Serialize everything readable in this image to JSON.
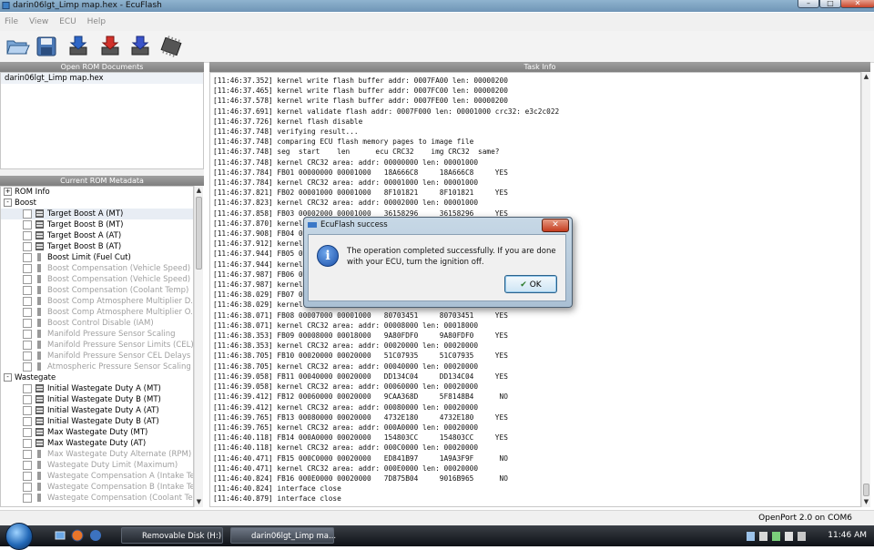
{
  "window": {
    "title": "darin06lgt_Limp map.hex - EcuFlash"
  },
  "menu": [
    "File",
    "View",
    "ECU",
    "Help"
  ],
  "toolbar": {
    "icons": [
      "open-folder-icon",
      "save-disk-icon",
      "read-rom-icon",
      "write-rom-icon",
      "test-write-icon",
      "chip-icon"
    ]
  },
  "left": {
    "open_docs_header": "Open ROM Documents",
    "open_docs": [
      "darin06lgt_Limp map.hex"
    ],
    "metadata_header": "Current ROM Metadata",
    "tree": [
      {
        "kind": "cat",
        "label": "ROM Info",
        "exp": "+"
      },
      {
        "kind": "cat",
        "label": "Boost",
        "exp": "-"
      },
      {
        "kind": "item",
        "label": "Target Boost A (MT)",
        "icon": "grid",
        "dim": false,
        "sel": true
      },
      {
        "kind": "item",
        "label": "Target Boost B (MT)",
        "icon": "grid",
        "dim": false
      },
      {
        "kind": "item",
        "label": "Target Boost A (AT)",
        "icon": "grid",
        "dim": false
      },
      {
        "kind": "item",
        "label": "Target Boost B (AT)",
        "icon": "grid",
        "dim": false
      },
      {
        "kind": "item",
        "label": "Boost Limit (Fuel Cut)",
        "icon": "bar",
        "dim": false
      },
      {
        "kind": "item",
        "label": "Boost Compensation (Vehicle Speed)",
        "icon": "bar",
        "dim": true
      },
      {
        "kind": "item",
        "label": "Boost Compensation (Vehicle Speed)",
        "icon": "bar",
        "dim": true
      },
      {
        "kind": "item",
        "label": "Boost Compensation (Coolant Temp)",
        "icon": "bar",
        "dim": true
      },
      {
        "kind": "item",
        "label": "Boost Comp Atmosphere Multiplier D...",
        "icon": "bar",
        "dim": true
      },
      {
        "kind": "item",
        "label": "Boost Comp Atmosphere Multiplier O...",
        "icon": "bar",
        "dim": true
      },
      {
        "kind": "item",
        "label": "Boost Control Disable (IAM)",
        "icon": "bar",
        "dim": true
      },
      {
        "kind": "item",
        "label": "Manifold Pressure Sensor Scaling",
        "icon": "bar",
        "dim": true
      },
      {
        "kind": "item",
        "label": "Manifold Pressure Sensor Limits (CEL)",
        "icon": "bar",
        "dim": true
      },
      {
        "kind": "item",
        "label": "Manifold Pressure Sensor CEL Delays",
        "icon": "bar",
        "dim": true
      },
      {
        "kind": "item",
        "label": "Atmospheric Pressure Sensor Scaling",
        "icon": "bar",
        "dim": true
      },
      {
        "kind": "cat",
        "label": "Wastegate",
        "exp": "-"
      },
      {
        "kind": "item",
        "label": "Initial Wastegate Duty A (MT)",
        "icon": "grid",
        "dim": false
      },
      {
        "kind": "item",
        "label": "Initial Wastegate Duty B (MT)",
        "icon": "grid",
        "dim": false
      },
      {
        "kind": "item",
        "label": "Initial Wastegate Duty A (AT)",
        "icon": "grid",
        "dim": false
      },
      {
        "kind": "item",
        "label": "Initial Wastegate Duty B (AT)",
        "icon": "grid",
        "dim": false
      },
      {
        "kind": "item",
        "label": "Max Wastegate Duty (MT)",
        "icon": "grid",
        "dim": false
      },
      {
        "kind": "item",
        "label": "Max Wastegate Duty (AT)",
        "icon": "grid",
        "dim": false
      },
      {
        "kind": "item",
        "label": "Max Wastegate Duty Alternate (RPM)",
        "icon": "bar",
        "dim": true
      },
      {
        "kind": "item",
        "label": "Wastegate Duty Limit (Maximum)",
        "icon": "bar",
        "dim": true
      },
      {
        "kind": "item",
        "label": "Wastegate Compensation A (Intake Te...",
        "icon": "bar",
        "dim": true
      },
      {
        "kind": "item",
        "label": "Wastegate Compensation B (Intake Te...",
        "icon": "bar",
        "dim": true
      },
      {
        "kind": "item",
        "label": "Wastegate Compensation (Coolant Te...",
        "icon": "bar",
        "dim": true
      }
    ]
  },
  "task_info": {
    "header": "Task Info",
    "lines": [
      "[11:46:37.352] kernel write flash buffer addr: 0007FA00 len: 00000200",
      "[11:46:37.465] kernel write flash buffer addr: 0007FC00 len: 00000200",
      "[11:46:37.578] kernel write flash buffer addr: 0007FE00 len: 00000200",
      "[11:46:37.691] kernel validate flash addr: 0007F000 len: 00001000 crc32: e3c2c022",
      "[11:46:37.726] kernel flash disable",
      "[11:46:37.748] verifying result...",
      "[11:46:37.748] comparing ECU flash memory pages to image file",
      "[11:46:37.748] seg  start    len      ecu CRC32    img CRC32  same?",
      "[11:46:37.748] kernel CRC32 area: addr: 00000000 len: 00001000",
      "[11:46:37.784] FB01 00000000 00001000   18A666C8     18A666C8     YES",
      "[11:46:37.784] kernel CRC32 area: addr: 00001000 len: 00001000",
      "[11:46:37.821] FB02 00001000 00001000   8F101821     8F101821     YES",
      "[11:46:37.823] kernel CRC32 area: addr: 00002000 len: 00001000",
      "[11:46:37.858] FB03 00002000 00001000   36158296     36158296     YES",
      "[11:46:37.870] kernel CRC32 area: addr: 00003000 len: 00001000",
      "[11:46:37.908] FB04 00003000 00001000   2A7E2C19     2A7E2C19     YES",
      "[11:46:37.912] kernel CRC32 area: addr: 00004000 len: 00001000",
      "[11:46:37.944] FB05 00004000 00001000   6C3D10A2     6C3D10A2     YES",
      "[11:46:37.944] kernel CRC32 area: addr: 00005000 len: 00001000",
      "[11:46:37.987] FB06 00005000 00001000   91B0E6D4     91B0E6D4     YES",
      "[11:46:37.987] kernel CRC32 area: addr: 00006000 len: 00001000",
      "[11:46:38.029] FB07 00006000 00001000   0E5A77C3     0E5A77C3     YES",
      "[11:46:38.029] kernel CRC32 area: addr: 00007000 len: 00001000",
      "[11:46:38.071] FB08 00007000 00001000   80703451     80703451     YES",
      "[11:46:38.071] kernel CRC32 area: addr: 00008000 len: 00018000",
      "[11:46:38.353] FB09 00008000 00018000   9A80FDF0     9A80FDF0     YES",
      "[11:46:38.353] kernel CRC32 area: addr: 00020000 len: 00020000",
      "[11:46:38.705] FB10 00020000 00020000   51C07935     51C07935     YES",
      "[11:46:38.705] kernel CRC32 area: addr: 00040000 len: 00020000",
      "[11:46:39.058] FB11 00040000 00020000   DD134C04     DD134C04     YES",
      "[11:46:39.058] kernel CRC32 area: addr: 00060000 len: 00020000",
      "[11:46:39.412] FB12 00060000 00020000   9CAA368D     5F8148B4      NO",
      "[11:46:39.412] kernel CRC32 area: addr: 00080000 len: 00020000",
      "[11:46:39.765] FB13 00080000 00020000   4732E180     4732E180     YES",
      "[11:46:39.765] kernel CRC32 area: addr: 000A0000 len: 00020000",
      "[11:46:40.118] FB14 000A0000 00020000   154803CC     154803CC     YES",
      "[11:46:40.118] kernel CRC32 area: addr: 000C0000 len: 00020000",
      "[11:46:40.471] FB15 000C0000 00020000   ED841B97     1A9A3F9F      NO",
      "[11:46:40.471] kernel CRC32 area: addr: 000E0000 len: 00020000",
      "[11:46:40.824] FB16 000E0000 00020000   7D875B04     9016B965      NO",
      "[11:46:40.824] interface close",
      "[11:46:40.879] interface close"
    ]
  },
  "dialog": {
    "title": "EcuFlash success",
    "message": "The operation completed successfully. If you are done with your ECU, turn the ignition off.",
    "ok_label": "OK",
    "close_glyph": "✕",
    "info_glyph": "i"
  },
  "status": {
    "text": "OpenPort 2.0 on COM6"
  },
  "taskbar": {
    "buttons": [
      "Removable Disk (H:)",
      "darin06lgt_Limp ma..."
    ],
    "clock": "11:46 AM"
  }
}
